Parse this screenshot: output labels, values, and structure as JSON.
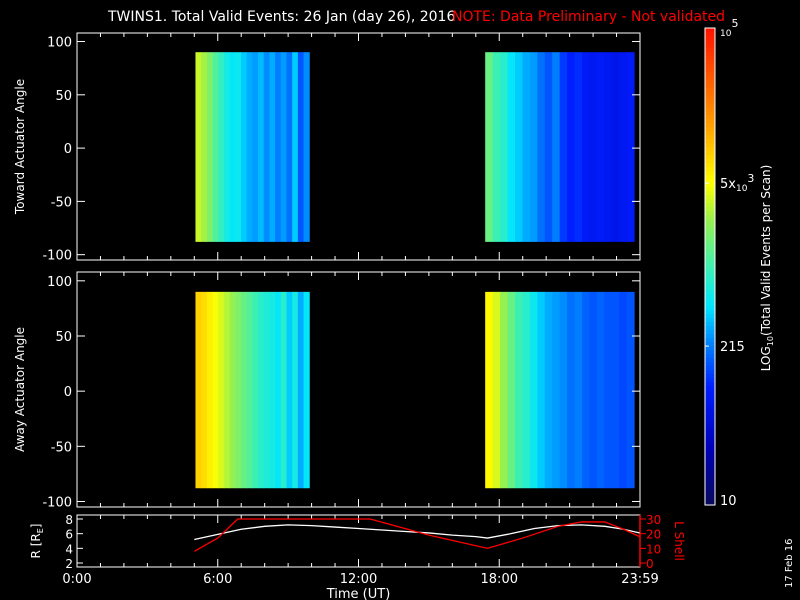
{
  "title": {
    "main": "TWINS1. Total Valid Events: 26 Jan (day  26), 2016",
    "note": "NOTE: Data Preliminary - Not validated",
    "note_color": "#ff0000"
  },
  "footer_date": "17 Feb 16",
  "chart_data": [
    {
      "type": "heatmap",
      "name": "toward",
      "ylabel": "Toward Actuator Angle",
      "ylim": [
        -105,
        108
      ],
      "yticks": [
        "100",
        "50",
        "0",
        "-50",
        "-100"
      ],
      "ytick_values": [
        100,
        50,
        0,
        -50,
        -100
      ],
      "angle_range": [
        -88,
        90
      ],
      "xlim_hours": [
        0,
        24
      ],
      "blocks": [
        {
          "start_hour": 5.05,
          "end_hour": 9.9,
          "log_counts": [
            3.55,
            3.45,
            3.3,
            3.1,
            2.95,
            2.8,
            2.7,
            2.75,
            2.6,
            2.5,
            2.45,
            2.55,
            2.4,
            2.5,
            2.35,
            2.45,
            2.3,
            2.6,
            2.2,
            2.4
          ]
        },
        {
          "start_hour": 17.4,
          "end_hour": 23.75,
          "log_counts": [
            3.2,
            3.0,
            2.9,
            2.7,
            2.6,
            2.5,
            2.45,
            2.3,
            2.2,
            2.35,
            2.1,
            2.0,
            2.05,
            1.95,
            1.9,
            1.95,
            1.9,
            1.85,
            1.9,
            1.95
          ]
        }
      ]
    },
    {
      "type": "heatmap",
      "name": "away",
      "ylabel": "Away Actuator Angle",
      "ylim": [
        -105,
        108
      ],
      "yticks": [
        "100",
        "50",
        "0",
        "-50",
        "-100"
      ],
      "ytick_values": [
        100,
        50,
        0,
        -50,
        -100
      ],
      "angle_range": [
        -88,
        90
      ],
      "xlim_hours": [
        0,
        24
      ],
      "blocks": [
        {
          "start_hour": 5.05,
          "end_hour": 9.9,
          "log_counts": [
            3.95,
            3.9,
            3.8,
            3.7,
            3.6,
            3.5,
            3.4,
            3.3,
            3.2,
            3.1,
            3.0,
            2.9,
            2.85,
            2.8,
            2.7,
            2.9,
            2.6,
            2.8,
            2.5,
            2.7
          ]
        },
        {
          "start_hour": 17.4,
          "end_hour": 23.75,
          "log_counts": [
            3.75,
            3.6,
            3.4,
            3.2,
            3.0,
            2.9,
            2.75,
            2.6,
            2.5,
            2.45,
            2.4,
            2.3,
            2.35,
            2.25,
            2.2,
            2.25,
            2.2,
            2.2,
            2.15,
            2.2
          ]
        }
      ]
    },
    {
      "type": "line",
      "name": "orbit",
      "xlabel": "Time (UT)",
      "xticks": [
        "0:00",
        "6:00",
        "12:00",
        "18:00",
        "23:59"
      ],
      "xtick_hours": [
        0,
        6,
        12,
        18,
        24
      ],
      "ylabel_left": "R [R",
      "ylabel_left_sub": "E",
      "ylabel_left_close": "]",
      "ylim_left": [
        2,
        8
      ],
      "yticks_left": [
        "8",
        "6",
        "4",
        "2"
      ],
      "ytick_left_values": [
        8,
        6,
        4,
        2
      ],
      "ylabel_right": "L Shell",
      "ylim_right": [
        0,
        30
      ],
      "yticks_right": [
        "30",
        "20",
        "10",
        "0"
      ],
      "ytick_right_values": [
        30,
        20,
        10,
        0
      ],
      "series": [
        {
          "name": "R",
          "color": "#ffffff",
          "x": [
            5.0,
            6.0,
            7.0,
            8.0,
            9.0,
            10.0,
            11.0,
            12.0,
            13.0,
            14.0,
            15.0,
            16.0,
            17.0,
            17.5,
            18.5,
            19.5,
            20.5,
            21.5,
            22.5,
            23.3,
            23.98
          ],
          "y": [
            5.2,
            5.9,
            6.6,
            7.0,
            7.2,
            7.1,
            6.9,
            6.7,
            6.5,
            6.3,
            6.1,
            5.8,
            5.6,
            5.4,
            6.0,
            6.7,
            7.1,
            7.2,
            7.0,
            6.6,
            6.1
          ]
        },
        {
          "name": "L Shell",
          "color": "#ff0000",
          "x": [
            5.0,
            6.0,
            6.85,
            12.5,
            15.0,
            17.5,
            19.0,
            20.5,
            21.5,
            22.5,
            23.3,
            23.98
          ],
          "y": [
            8,
            17,
            30,
            30,
            19,
            10,
            17,
            25,
            28,
            28,
            23,
            18
          ]
        }
      ]
    },
    {
      "type": "colorbar",
      "label": "LOG10(Total Valid Events per Scan)",
      "label_pre": "LOG",
      "label_sub": "10",
      "label_post": "(Total Valid Events per Scan)",
      "range": [
        10,
        100000
      ],
      "ticks": [
        {
          "value": 100000,
          "base": "10",
          "exp": "5"
        },
        {
          "value": 5000,
          "mant": "5x",
          "base": "10",
          "exp": "3"
        },
        {
          "value": 215,
          "text": "215"
        },
        {
          "value": 10,
          "text": "10"
        }
      ]
    }
  ]
}
